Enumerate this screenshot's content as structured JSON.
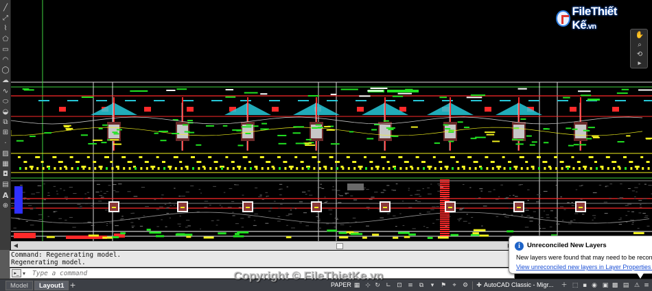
{
  "toolbar": {
    "tools": [
      {
        "name": "line-tool-icon",
        "glyph": "╱"
      },
      {
        "name": "construction-line-tool-icon",
        "glyph": "⤢"
      },
      {
        "name": "polyline-tool-icon",
        "glyph": "⌇"
      },
      {
        "name": "polygon-tool-icon",
        "glyph": "⬠"
      },
      {
        "name": "rectangle-tool-icon",
        "glyph": "▭"
      },
      {
        "name": "arc-tool-icon",
        "glyph": "◠"
      },
      {
        "name": "circle-tool-icon",
        "glyph": "◯"
      },
      {
        "name": "revision-cloud-tool-icon",
        "glyph": "☁"
      },
      {
        "name": "spline-tool-icon",
        "glyph": "∿"
      },
      {
        "name": "ellipse-tool-icon",
        "glyph": "⬭"
      },
      {
        "name": "ellipse-arc-tool-icon",
        "glyph": "◒"
      },
      {
        "name": "insert-block-tool-icon",
        "glyph": "⧉"
      },
      {
        "name": "make-block-tool-icon",
        "glyph": "⊞"
      },
      {
        "name": "point-tool-icon",
        "glyph": "·"
      },
      {
        "name": "hatch-tool-icon",
        "glyph": "▨"
      },
      {
        "name": "gradient-tool-icon",
        "glyph": "▦"
      },
      {
        "name": "region-tool-icon",
        "glyph": "◘"
      },
      {
        "name": "table-tool-icon",
        "glyph": "▤"
      },
      {
        "name": "multiline-text-tool-icon",
        "glyph": "A"
      },
      {
        "name": "add-selected-tool-icon",
        "glyph": "⊕"
      }
    ]
  },
  "logo": {
    "brand": "File",
    "name": "Thiết Kế",
    "ext": ".vn"
  },
  "command_history": [
    "Command: Regenerating model.",
    "Regenerating model."
  ],
  "command_line": {
    "placeholder": "Type a command"
  },
  "layout_tabs": {
    "model": "Model",
    "layout1": "Layout1",
    "add": "+"
  },
  "statusbar": {
    "space": "PAPER",
    "workspace": "AutoCAD Classic - Migr..."
  },
  "balloon": {
    "title": "Unreconciled New Layers",
    "message": "New layers were found that may need to be reconcile",
    "link": "View unreconciled new layers in Layer Properties Ma"
  },
  "watermark": {
    "copyright": "Copyright © FileThietKe.vn"
  },
  "colors": {
    "canvas": "#000000",
    "frame_green": "#3fd43f",
    "cad_red": "#ff2a2a",
    "cad_yellow": "#f2f21e",
    "cad_cyan": "#27c9d9",
    "cad_green": "#22e322",
    "info_blue": "#1e63c7"
  }
}
